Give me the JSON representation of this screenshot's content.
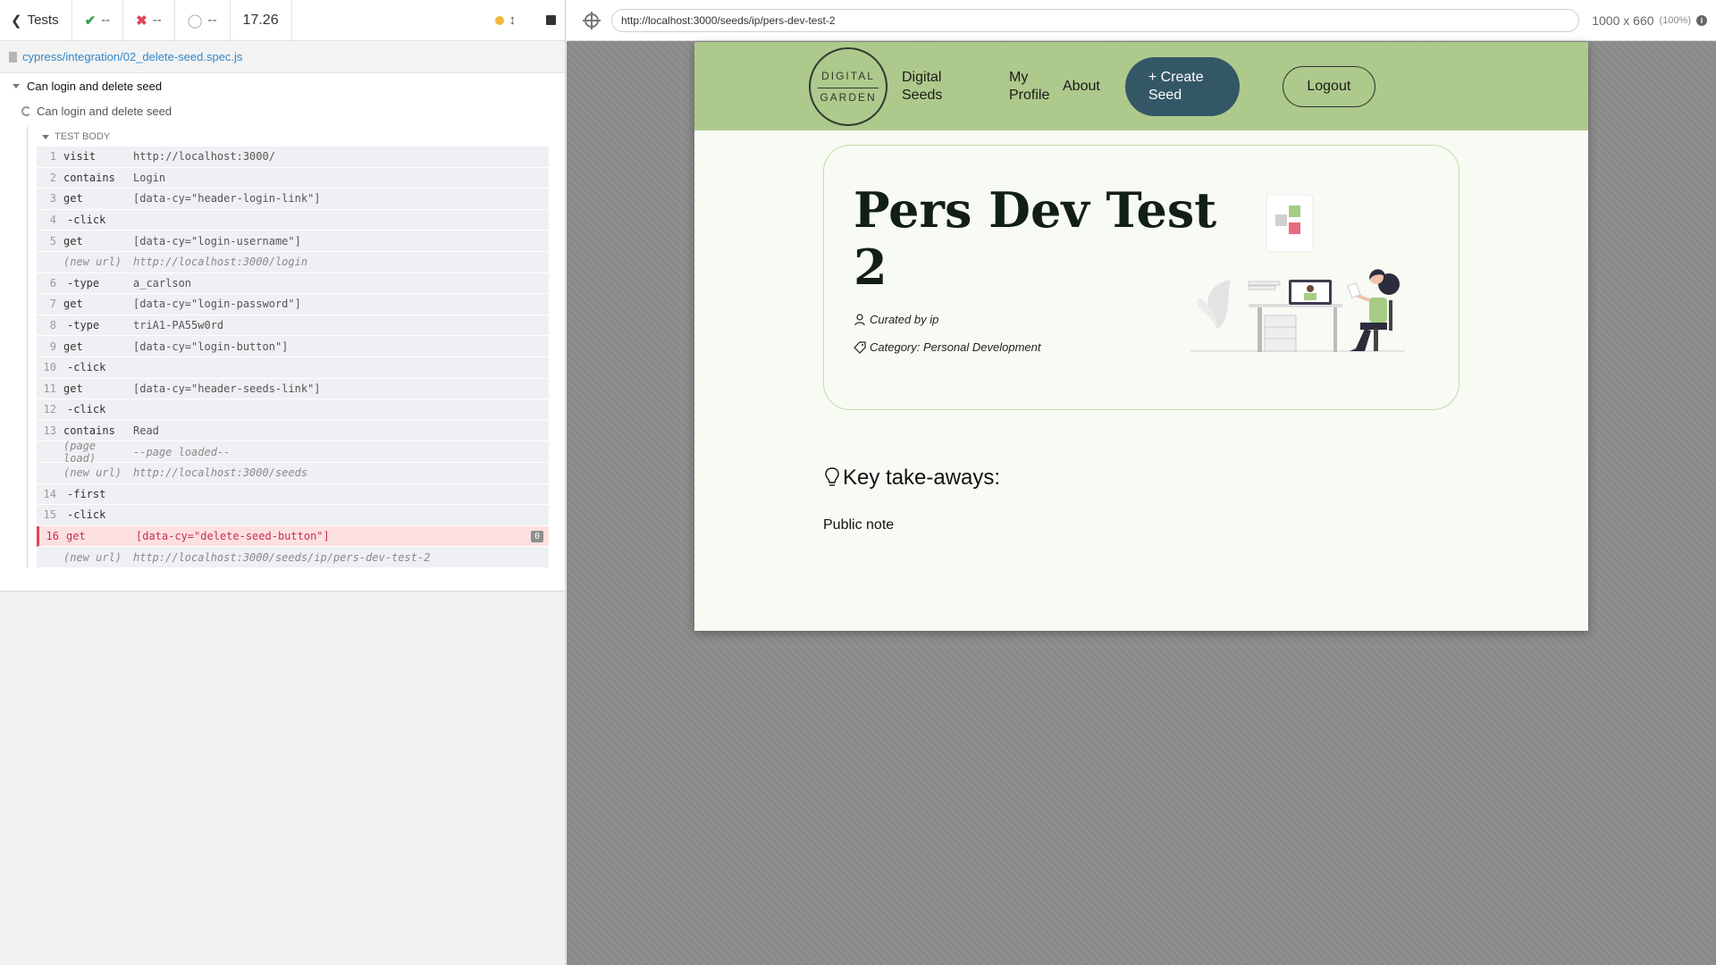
{
  "reporter": {
    "tests_label": "Tests",
    "passed": "--",
    "failed": "--",
    "pending": "--",
    "duration": "17.26",
    "spec_path": "cypress/integration/02_delete-seed.spec.js",
    "suite_title": "Can login and delete seed",
    "test_title": "Can login and delete seed",
    "test_body_label": "TEST BODY",
    "commands": [
      {
        "num": "1",
        "name": "visit",
        "msg": "http://localhost:3000/",
        "type": "cmd"
      },
      {
        "num": "2",
        "name": "contains",
        "msg": "Login",
        "type": "cmd"
      },
      {
        "num": "3",
        "name": "get",
        "msg": "[data-cy=\"header-login-link\"]",
        "type": "cmd"
      },
      {
        "num": "4",
        "name": "-click",
        "msg": "",
        "type": "child"
      },
      {
        "num": "5",
        "name": "get",
        "msg": "[data-cy=\"login-username\"]",
        "type": "cmd"
      },
      {
        "num": "",
        "name": "(new url)",
        "msg": "http://localhost:3000/login",
        "type": "event"
      },
      {
        "num": "6",
        "name": "-type",
        "msg": "a_carlson",
        "type": "child"
      },
      {
        "num": "7",
        "name": "get",
        "msg": "[data-cy=\"login-password\"]",
        "type": "cmd"
      },
      {
        "num": "8",
        "name": "-type",
        "msg": "triA1-PA55w0rd",
        "type": "child"
      },
      {
        "num": "9",
        "name": "get",
        "msg": "[data-cy=\"login-button\"]",
        "type": "cmd"
      },
      {
        "num": "10",
        "name": "-click",
        "msg": "",
        "type": "child"
      },
      {
        "num": "11",
        "name": "get",
        "msg": "[data-cy=\"header-seeds-link\"]",
        "type": "cmd"
      },
      {
        "num": "12",
        "name": "-click",
        "msg": "",
        "type": "child"
      },
      {
        "num": "13",
        "name": "contains",
        "msg": "Read",
        "type": "cmd"
      },
      {
        "num": "",
        "name": "(page load)",
        "msg": "--page loaded--",
        "type": "event"
      },
      {
        "num": "",
        "name": "(new url)",
        "msg": "http://localhost:3000/seeds",
        "type": "event"
      },
      {
        "num": "14",
        "name": "-first",
        "msg": "",
        "type": "child"
      },
      {
        "num": "15",
        "name": "-click",
        "msg": "",
        "type": "child"
      },
      {
        "num": "16",
        "name": "get",
        "msg": "[data-cy=\"delete-seed-button\"]",
        "type": "failed",
        "badge": "0"
      },
      {
        "num": "",
        "name": "(new url)",
        "msg": "http://localhost:3000/seeds/ip/pers-dev-test-2",
        "type": "event"
      }
    ]
  },
  "aut": {
    "url": "http://localhost:3000/seeds/ip/pers-dev-test-2",
    "viewport": "1000 x 660",
    "zoom": "(100%)"
  },
  "app": {
    "logo_top": "DIGITAL",
    "logo_bottom": "GARDEN",
    "nav": {
      "seeds": "Digital Seeds",
      "profile": "My Profile",
      "about": "About",
      "create": "+ Create Seed",
      "logout": "Logout"
    },
    "seed": {
      "title": "Pers Dev Test 2",
      "author": "Curated by ip",
      "category": "Category: Personal Development"
    },
    "takeaways_heading": "Key take-aways:",
    "public_note": "Public note"
  },
  "colors": {
    "nav_bg": "#aec98c",
    "create_btn": "#345766",
    "failed_row": "#fde0e0",
    "link_blue": "#3386c6"
  }
}
